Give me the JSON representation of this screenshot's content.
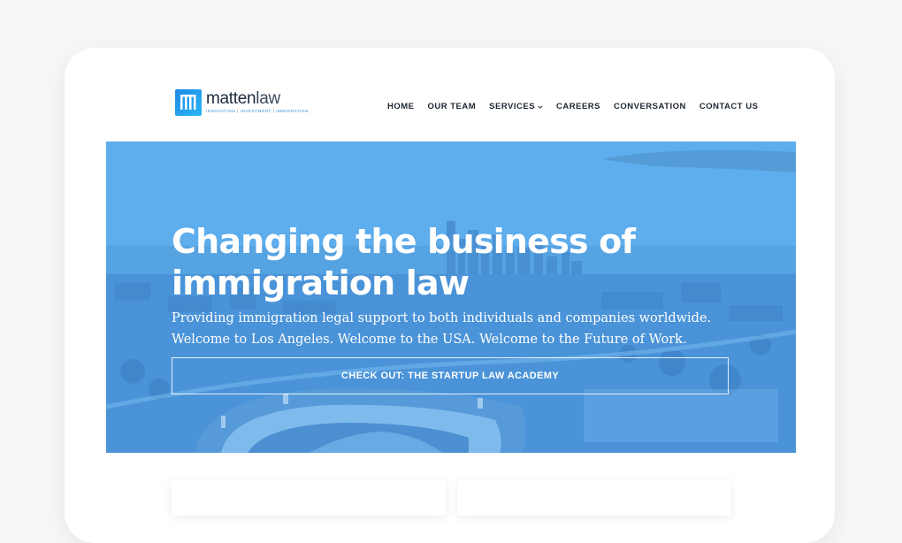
{
  "brand": {
    "name_bold": "matten",
    "name_light": "law",
    "tagline": "innovation | investment | immigration",
    "accent": "#2b8ad6"
  },
  "nav": {
    "items": [
      {
        "label": "HOME"
      },
      {
        "label": "OUR TEAM"
      },
      {
        "label": "SERVICES",
        "has_dropdown": true
      },
      {
        "label": "CAREERS"
      },
      {
        "label": "CONVERSATION"
      },
      {
        "label": "CONTACT US"
      }
    ]
  },
  "hero": {
    "title_line1": "Changing the business of",
    "title_line2": "immigration law",
    "subtitle_line1": "Providing immigration legal support to both individuals and companies worldwide.",
    "subtitle_line2": "Welcome to Los Angeles. Welcome to the USA. Welcome to the Future of Work.",
    "cta_label": "CHECK OUT: THE STARTUP LAW ACADEMY",
    "overlay_color": "#4a9ee6"
  }
}
